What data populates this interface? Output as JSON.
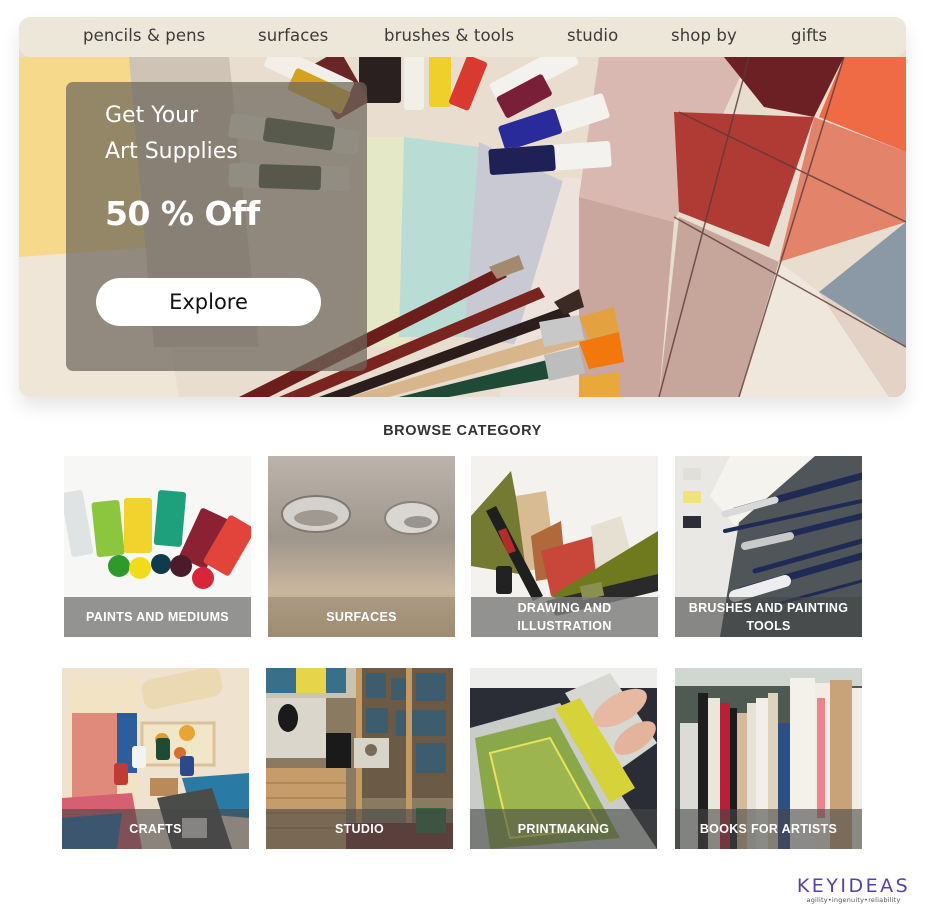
{
  "nav": {
    "items": [
      {
        "label": "pencils & pens"
      },
      {
        "label": "surfaces"
      },
      {
        "label": "brushes & tools"
      },
      {
        "label": "studio"
      },
      {
        "label": "shop by"
      },
      {
        "label": "gifts"
      }
    ]
  },
  "hero": {
    "line1": "Get Your",
    "line2": "Art Supplies",
    "offer": "50 % Off",
    "cta_label": "Explore",
    "image": "paint-tubes-brushes-and-color-swatches"
  },
  "browse": {
    "title": "BROWSE CATEGORY",
    "categories": [
      {
        "label": "PAINTS AND MEDIUMS",
        "image": "paint-tubes-photo"
      },
      {
        "label": "SURFACES",
        "image": "water-drops-on-wood-photo"
      },
      {
        "label": "DRAWING AND ILLUSTRATION",
        "image": "markers-and-paper-photo"
      },
      {
        "label": "BRUSHES AND PAINTING TOOLS",
        "image": "brushes-and-palette-photo"
      },
      {
        "label": "CRAFTS",
        "image": "marbled-paper-crafts-photo"
      },
      {
        "label": "STUDIO",
        "image": "art-studio-photo"
      },
      {
        "label": "PRINTMAKING",
        "image": "screen-printing-photo"
      },
      {
        "label": "BOOKS FOR ARTISTS",
        "image": "art-books-shelf-photo"
      }
    ]
  },
  "logo": {
    "name": "KEYIDEAS",
    "tagline": "agility•ingenuity•reliability",
    "color": "#5b3fa8"
  },
  "colors": {
    "nav_bg": "#ede7da",
    "promo_overlay": "#6e665c",
    "button_bg": "#ffffff",
    "title_text": "#333333"
  }
}
